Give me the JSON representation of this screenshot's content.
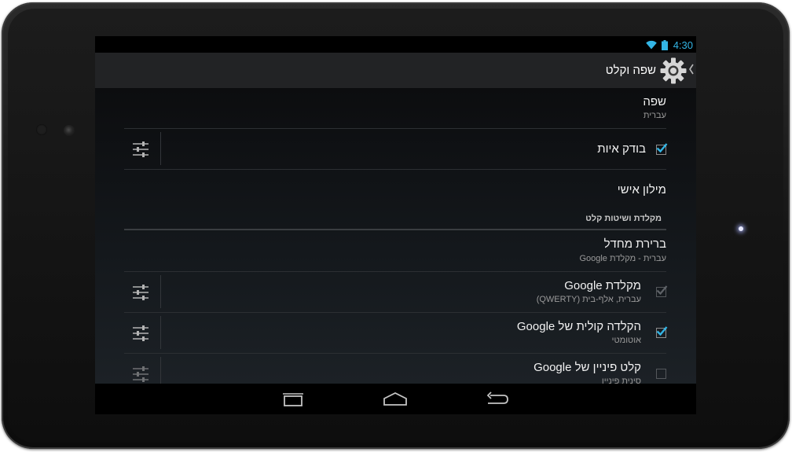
{
  "status_bar": {
    "time": "4:30",
    "icons": [
      "wifi-icon",
      "battery-icon"
    ],
    "accent_color": "#33b5e5"
  },
  "action_bar": {
    "title": "שפה וקלט",
    "icon": "settings-gear-icon"
  },
  "settings": {
    "language": {
      "title": "שפה",
      "summary": "עברית"
    },
    "spell_checker": {
      "title": "בודק איות",
      "checked": true
    },
    "personal_dictionary": {
      "title": "מילון אישי"
    },
    "keyboards_section": {
      "header": "מקלדת ושיטות קלט"
    },
    "default_input": {
      "title": "ברירת מחדל",
      "summary": "עברית - מקלדת Google"
    },
    "google_keyboard": {
      "title": "מקלדת Google",
      "summary": "עברית, אלף-בית (QWERTY)",
      "checked": true,
      "disabled": true
    },
    "google_voice_typing": {
      "title": "הקלדה קולית של Google",
      "summary": "אוטומטי",
      "checked": true
    },
    "google_pinyin": {
      "title": "קלט פיניין של Google",
      "summary": "סינית פיניין",
      "checked": false
    }
  },
  "navigation_bar": {
    "buttons": [
      "recent-apps-icon",
      "home-icon",
      "back-icon"
    ]
  },
  "colors": {
    "checkbox_check": "#33b5e5",
    "background": "#101215"
  }
}
